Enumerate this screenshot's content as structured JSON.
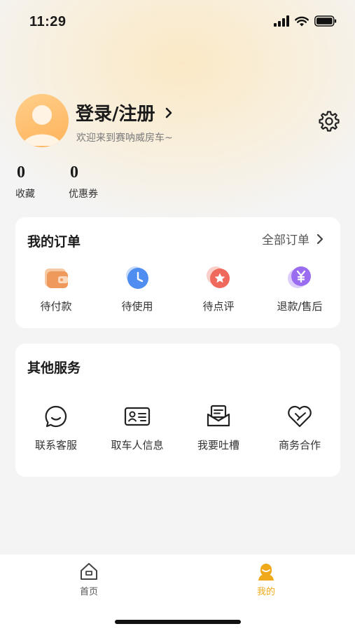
{
  "status_bar": {
    "time": "11:29"
  },
  "profile": {
    "title": "登录/注册",
    "subtitle": "欢迎来到赛呐威房车~"
  },
  "stats": [
    {
      "value": "0",
      "label": "收藏"
    },
    {
      "value": "0",
      "label": "优惠券"
    }
  ],
  "orders": {
    "title": "我的订单",
    "all_link": "全部订单",
    "items": [
      {
        "label": "待付款",
        "icon": "wallet-icon"
      },
      {
        "label": "待使用",
        "icon": "clock-icon"
      },
      {
        "label": "待点评",
        "icon": "star-comment-icon"
      },
      {
        "label": "退款/售后",
        "icon": "yen-refund-icon"
      }
    ]
  },
  "services": {
    "title": "其他服务",
    "items": [
      {
        "label": "联系客服",
        "icon": "chat-smile-icon"
      },
      {
        "label": "取车人信息",
        "icon": "id-card-icon"
      },
      {
        "label": "我要吐槽",
        "icon": "mail-open-icon"
      },
      {
        "label": "商务合作",
        "icon": "handshake-heart-icon"
      }
    ]
  },
  "tabbar": {
    "items": [
      {
        "label": "首页",
        "icon": "home-icon",
        "active": false
      },
      {
        "label": "我的",
        "icon": "person-icon",
        "active": true
      }
    ]
  },
  "colors": {
    "accent": "#f0a91b",
    "avatar": "#ffb25a"
  }
}
